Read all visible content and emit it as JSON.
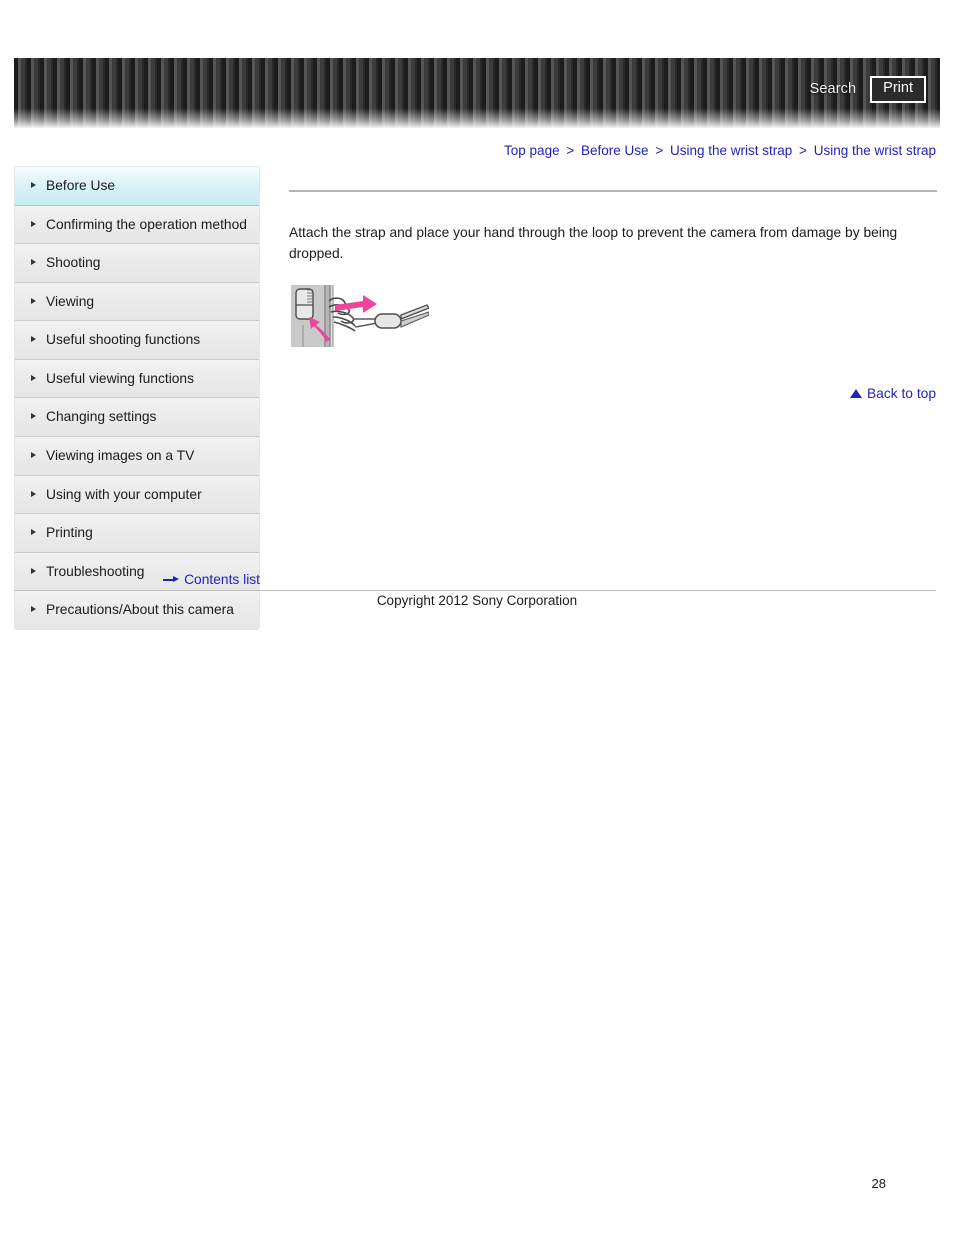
{
  "header": {
    "search_label": "Search",
    "print_label": "Print",
    "search_icon": "search-icon",
    "print_icon": "print-icon"
  },
  "breadcrumb": {
    "separator": ">",
    "items": [
      {
        "label": "Top page"
      },
      {
        "label": "Before Use"
      },
      {
        "label": "Using the wrist strap"
      },
      {
        "label": "Using the wrist strap"
      }
    ]
  },
  "sidebar": {
    "items": [
      {
        "label": "Before Use",
        "active": true
      },
      {
        "label": "Confirming the operation method",
        "active": false
      },
      {
        "label": "Shooting",
        "active": false
      },
      {
        "label": "Viewing",
        "active": false
      },
      {
        "label": "Useful shooting functions",
        "active": false
      },
      {
        "label": "Useful viewing functions",
        "active": false
      },
      {
        "label": "Changing settings",
        "active": false
      },
      {
        "label": "Viewing images on a TV",
        "active": false
      },
      {
        "label": "Using with your computer",
        "active": false
      },
      {
        "label": "Printing",
        "active": false
      },
      {
        "label": "Troubleshooting",
        "active": false
      },
      {
        "label": "Precautions/About this camera",
        "active": false
      }
    ],
    "contents_list_label": "Contents list",
    "contents_list_icon": "arrow-right-icon"
  },
  "main": {
    "body_text": "Attach the strap and place your hand through the loop to prevent the camera from damage by being dropped.",
    "figure_alt": "wrist-strap-attachment-illustration",
    "back_to_top_label": "Back to top",
    "back_to_top_icon": "triangle-up-icon"
  },
  "footer": {
    "copyright": "Copyright 2012 Sony Corporation",
    "page_number": "28"
  },
  "colors": {
    "link": "#2222bb",
    "banner_dark": "#1c1c1c",
    "banner_light": "#565656",
    "active_nav": "#c8ebf4",
    "arrow_accent": "#f0449a",
    "text": "#1b1b1b",
    "rule": "#b4b4b4"
  }
}
